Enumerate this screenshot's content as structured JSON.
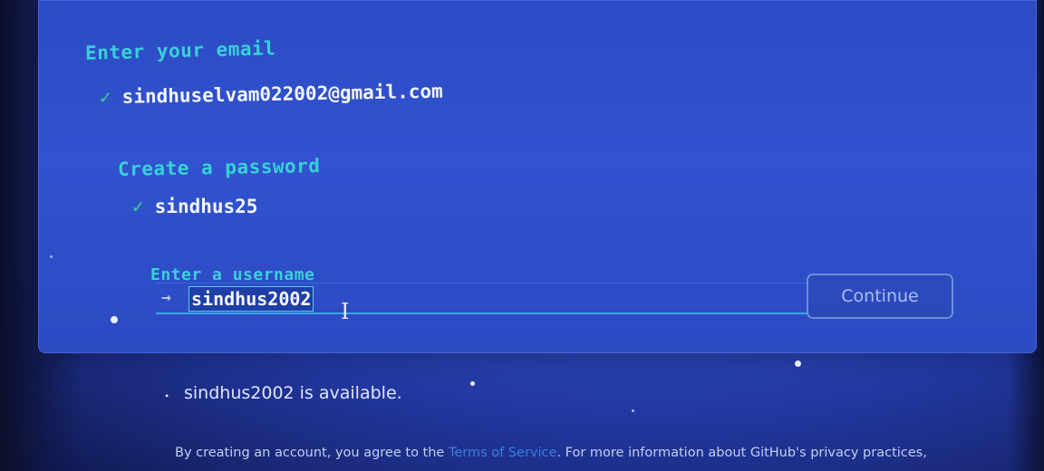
{
  "form": {
    "email_label": "Enter your email",
    "email_value": "sindhuselvam022002@gmail.com",
    "password_label": "Create a password",
    "password_value": "sindhus25",
    "username_label": "Enter a username",
    "username_value": "sindhus2002",
    "continue_label": "Continue",
    "check_glyph": "✓",
    "arrow_glyph": "→"
  },
  "status": {
    "availability_text": "sindhus2002 is available."
  },
  "footer": {
    "text_before_link": "By creating an account, you agree to the ",
    "terms_link": "Terms of Service",
    "text_after_link": ". For more information about GitHub's privacy practices,"
  },
  "colors": {
    "label": "#39d1d9",
    "check": "#3fd38a",
    "link": "#3b7fe0",
    "background": "#2c4bc4"
  }
}
